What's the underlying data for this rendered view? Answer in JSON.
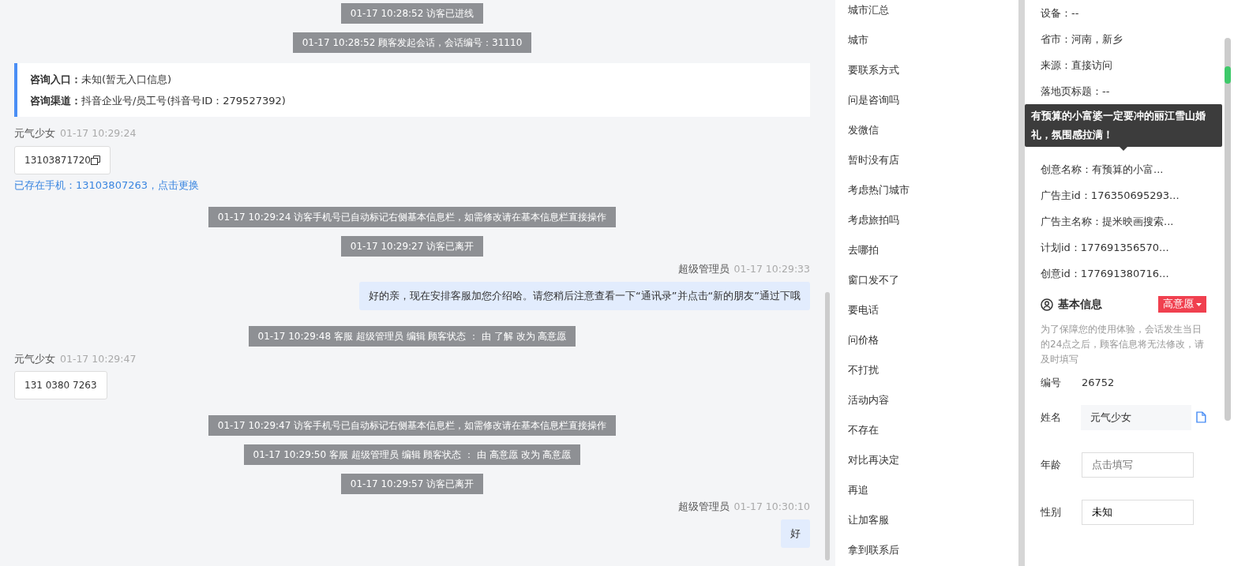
{
  "chat": [
    {
      "kind": "system",
      "text": "01-17 10:28:52 访客已进线"
    },
    {
      "kind": "system",
      "text": "01-17 10:28:52 顾客发起会话，会话编号：31110"
    },
    {
      "kind": "info",
      "lines": [
        {
          "label": "咨询入口：",
          "value": "未知(暂无入口信息)"
        },
        {
          "label": "咨询渠道：",
          "value": "抖音企业号/员工号(抖音号ID：279527392)"
        }
      ]
    },
    {
      "kind": "visitor",
      "name": "元气少女",
      "time": "01-17 10:29:24",
      "text": "13103871720",
      "copyable": true,
      "note": "已存在手机：13103807263，点击更换"
    },
    {
      "kind": "system",
      "text": "01-17 10:29:24 访客手机号已自动标记右侧基本信息栏，如需修改请在基本信息栏直接操作"
    },
    {
      "kind": "system",
      "text": "01-17 10:29:27 访客已离开"
    },
    {
      "kind": "agent",
      "name": "超级管理员",
      "time": "01-17 10:29:33",
      "text": "好的亲，现在安排客服加您介绍哈。请您稍后注意查看一下“通讯录”并点击“新的朋友”通过下哦"
    },
    {
      "kind": "system",
      "text": "01-17 10:29:48 客服 超级管理员 编辑 顾客状态 ： 由 了解 改为 高意愿"
    },
    {
      "kind": "visitor",
      "name": "元气少女",
      "time": "01-17 10:29:47",
      "text": "131 0380 7263",
      "copyable": false
    },
    {
      "kind": "system",
      "text": "01-17 10:29:47 访客手机号已自动标记右侧基本信息栏，如需修改请在基本信息栏直接操作"
    },
    {
      "kind": "system",
      "text": "01-17 10:29:50 客服 超级管理员 编辑 顾客状态 ： 由 高意愿 改为 高意愿"
    },
    {
      "kind": "system",
      "text": "01-17 10:29:57 访客已离开"
    },
    {
      "kind": "agent",
      "name": "超级管理员",
      "time": "01-17 10:30:10",
      "text": "好"
    }
  ],
  "quick_replies": [
    "城市汇总",
    "城市",
    "要联系方式",
    "问是咨询吗",
    "发微信",
    "暂时没有店",
    "考虑热门城市",
    "考虑旅拍吗",
    "去哪拍",
    "窗口发不了",
    "要电话",
    "问价格",
    "不打扰",
    "活动内容",
    "不存在",
    "对比再决定",
    "再追",
    "让加客服",
    "拿到联系后"
  ],
  "visit_info": [
    {
      "text": "设备：--"
    },
    {
      "text": "省市：河南，新乡"
    },
    {
      "text": "来源：直接访问"
    },
    {
      "text": "落地页标题：--"
    },
    {
      "tooltip": "有预算的小富婆一定要冲的丽江雪山婚礼，氛围感拉满！"
    },
    {
      "text": "创意名称：有预算的小富..."
    },
    {
      "text": "广告主id：176350695293..."
    },
    {
      "text": "广告主名称：提米映画搜索..."
    },
    {
      "text": "计划id：177691356570..."
    },
    {
      "text": "创意id：177691380716..."
    }
  ],
  "basic_info": {
    "title": "基本信息",
    "status": "高意愿",
    "hint": "为了保障您的使用体验，会话发生当日的24点之后，顾客信息将无法修改，请及时填写",
    "fields": [
      {
        "kind": "text",
        "label": "编号",
        "value": "26752"
      },
      {
        "kind": "readonly",
        "label": "姓名",
        "value": "元气少女"
      },
      {
        "kind": "input",
        "label": "年龄",
        "placeholder": "点击填写"
      },
      {
        "kind": "input",
        "label": "性别",
        "value": "未知"
      }
    ]
  }
}
